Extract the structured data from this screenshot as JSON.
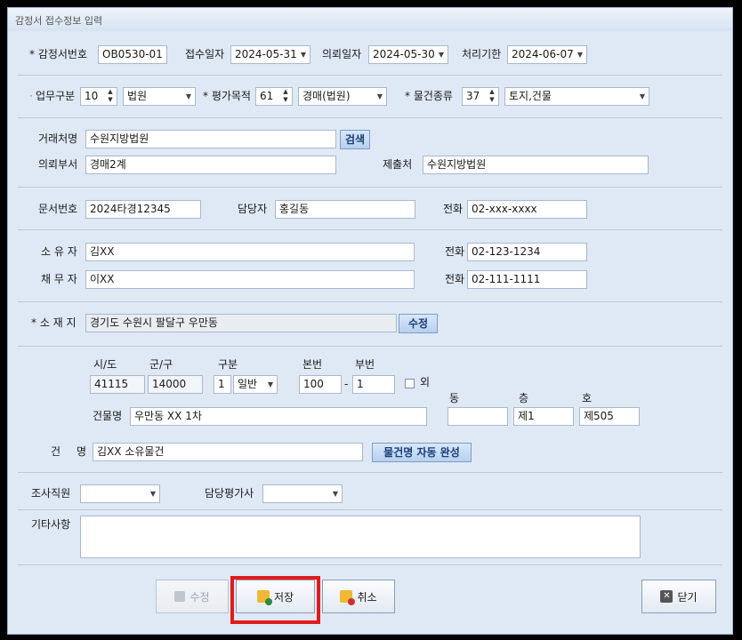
{
  "window": {
    "title": "감정서 접수정보 입력"
  },
  "row1": {
    "appraisal_no_label": "* 감정서번호",
    "appraisal_no": "OB0530-01",
    "receipt_date_label": "접수일자",
    "receipt_date": "2024-05-31",
    "request_date_label": "의뢰일자",
    "request_date": "2024-05-30",
    "deadline_label": "처리기한",
    "deadline": "2024-06-07"
  },
  "row2": {
    "business_type_label": "업무구분",
    "business_type_code": "10",
    "business_type": "법원",
    "purpose_label": "* 평가목적",
    "purpose_code": "61",
    "purpose": "경매(법원)",
    "property_type_label": "* 물건종류",
    "property_type_code": "37",
    "property_type": "토지,건물"
  },
  "client": {
    "client_label": "거래처명",
    "client": "수원지방법원",
    "search_button": "검색",
    "dept_label": "의뢰부서",
    "dept": "경매2계",
    "submit_label": "제출처",
    "submit_to": "수원지방법원"
  },
  "doc": {
    "doc_no_label": "문서번호",
    "doc_no": "2024타경12345",
    "manager_label": "담당자",
    "manager": "홍길동",
    "phone_label": "전화",
    "phone": "02-xxx-xxxx"
  },
  "parties": {
    "owner_label": "소 유 자",
    "owner": "김XX",
    "owner_phone_label": "전화",
    "owner_phone": "02-123-1234",
    "debtor_label": "채 무 자",
    "debtor": "이XX",
    "debtor_phone_label": "전화",
    "debtor_phone": "02-111-1111"
  },
  "location": {
    "label": "* 소 재 지",
    "address": "경기도 수원시 팔달구 우만동",
    "edit_button": "수정"
  },
  "lot": {
    "sido_label": "시/도",
    "sido": "41115",
    "gungu_label": "군/구",
    "gungu": "14000",
    "type_label": "구분",
    "type_code": "1",
    "type": "일반",
    "main_no_label": "본번",
    "main_no": "100",
    "dash": "-",
    "sub_no_label": "부번",
    "sub_no": "1",
    "other_label": "외",
    "building_label": "건물명",
    "building": "우만동 XX 1차",
    "dong_label": "동",
    "dong": "",
    "floor_label": "층",
    "floor": "제1",
    "ho_label": "호",
    "ho": "제505"
  },
  "item": {
    "label_a": "건",
    "label_b": "명",
    "name": "김XX 소유물건",
    "autofill_button": "물건명 자동 완성"
  },
  "staff": {
    "investigator_label": "조사직원",
    "investigator": "",
    "appraiser_label": "담당평가사",
    "appraiser": ""
  },
  "notes": {
    "label": "기타사항",
    "value": ""
  },
  "buttons": {
    "edit": "수정",
    "save": "저장",
    "cancel": "취소",
    "close": "닫기"
  },
  "colors": {
    "window_bg": "#dfe9f5",
    "highlight": "#e11b1b",
    "accent_button": "#b7d0ee"
  }
}
